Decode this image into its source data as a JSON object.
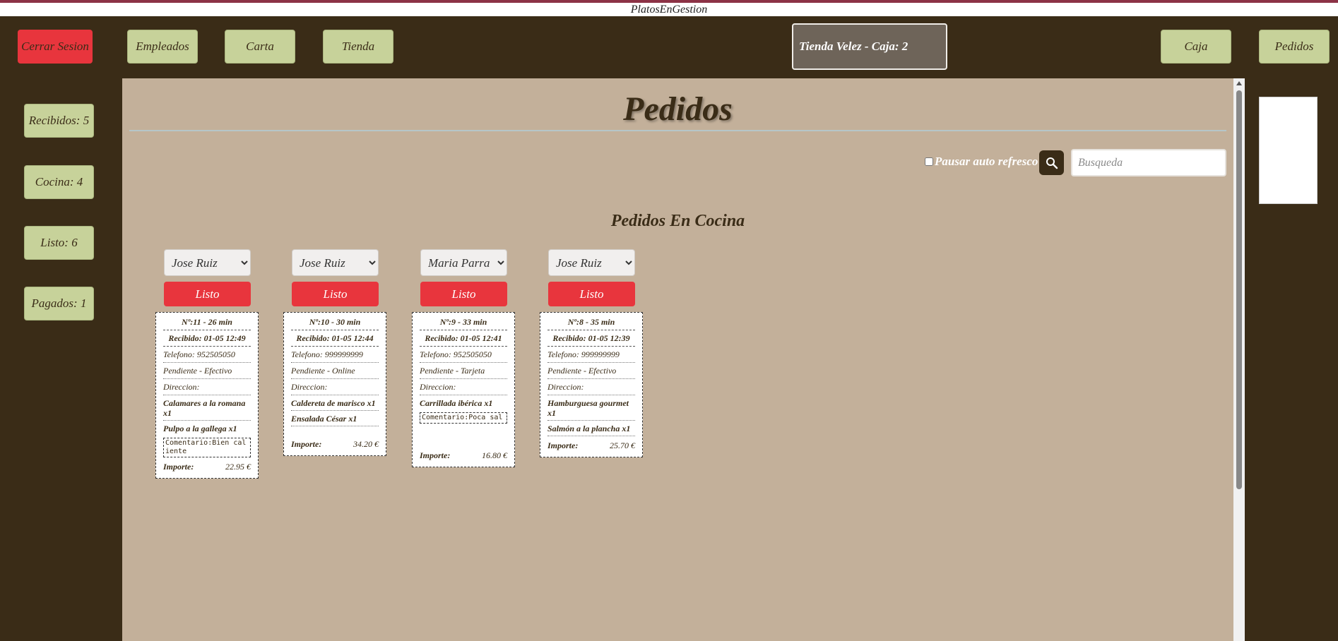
{
  "app": {
    "title": "PlatosEnGestion"
  },
  "topnav": {
    "logout": "Cerrar Sesion",
    "employees": "Empleados",
    "menu": "Carta",
    "store": "Tienda",
    "store_info": "Tienda Velez - Caja: 2",
    "register": "Caja",
    "orders": "Pedidos"
  },
  "sidebar": {
    "items": [
      {
        "label": "Recibidos: 5"
      },
      {
        "label": "Cocina: 4"
      },
      {
        "label": "Listo: 6"
      },
      {
        "label": "Pagados: 1"
      }
    ]
  },
  "main": {
    "title": "Pedidos",
    "pause_label": "Pausar auto refresco",
    "search_placeholder": "Busqueda",
    "section_title": "Pedidos En Cocina",
    "orders": [
      {
        "employee": "Jose Ruiz",
        "button": "Listo",
        "header": "Nº:11 - 26 min",
        "received": "Recibido: 01-05 12:49",
        "phone": "Telefono: 952505050",
        "status": "Pendiente - Efectivo",
        "address": "Direccion:",
        "items": [
          "Calamares a la romana x1",
          "Pulpo a la gallega x1"
        ],
        "comment": "Comentario:Bien caliente",
        "total_label": "Importe:",
        "total": "22.95 €"
      },
      {
        "employee": "Jose Ruiz",
        "button": "Listo",
        "header": "Nº:10 - 30 min",
        "received": "Recibido: 01-05 12:44",
        "phone": "Telefono: 999999999",
        "status": "Pendiente - Online",
        "address": "Direccion:",
        "items": [
          "Caldereta de marisco x1",
          "Ensalada César x1"
        ],
        "comment": "",
        "total_label": "Importe:",
        "total": "34.20 €"
      },
      {
        "employee": "Maria Parra",
        "button": "Listo",
        "header": "Nº:9 - 33 min",
        "received": "Recibido: 01-05 12:41",
        "phone": "Telefono: 952505050",
        "status": "Pendiente - Tarjeta",
        "address": "Direccion:",
        "items": [
          "Carrillada ibérica x1"
        ],
        "comment": "Comentario:Poca sal",
        "total_label": "Importe:",
        "total": "16.80 €"
      },
      {
        "employee": "Jose Ruiz",
        "button": "Listo",
        "header": "Nº:8 - 35 min",
        "received": "Recibido: 01-05 12:39",
        "phone": "Telefono: 999999999",
        "status": "Pendiente - Efectivo",
        "address": "Direccion:",
        "items": [
          "Hamburguesa gourmet x1",
          "Salmón a la plancha x1"
        ],
        "comment": "",
        "total_label": "Importe:",
        "total": "25.70 €"
      }
    ]
  },
  "colors": {
    "background": "#3a2c17",
    "panel": "#c3b09a",
    "nav_button": "#c7d29a",
    "danger": "#e8353d",
    "store_box": "#6e6459"
  },
  "icons": {
    "search": "search-icon"
  }
}
